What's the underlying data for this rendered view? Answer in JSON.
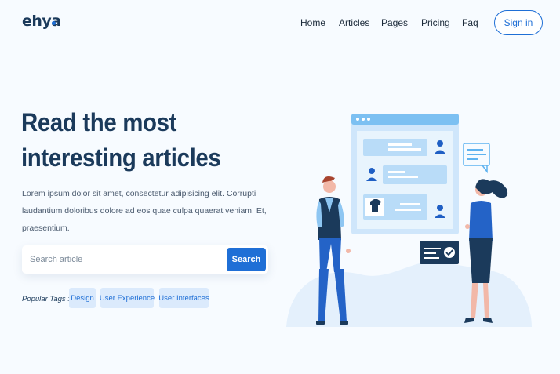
{
  "brand": {
    "logo_text": "ehya",
    "accent": "#1f6fd6",
    "dark": "#1b3a5b"
  },
  "nav": {
    "items": [
      "Home",
      "Articles",
      "Pages",
      "Pricing",
      "Faq"
    ],
    "signin_label": "Sign in"
  },
  "hero": {
    "headline_line1": "Read the most",
    "headline_line2": "interesting articles",
    "description": "Lorem ipsum dolor sit amet, consectetur adipisicing elit. Corrupti laudantium doloribus dolore ad eos quae culpa quaerat veniam. Et, praesentium."
  },
  "search": {
    "placeholder": "Search article",
    "button_label": "Search"
  },
  "tags": {
    "label": "Popular Tags :",
    "items": [
      "Design",
      "User Experience",
      "User Interfaces"
    ]
  },
  "illustration": {
    "icons": [
      "browser-window-icon",
      "user-icon",
      "tshirt-icon",
      "chat-bubble-icon",
      "check-card-icon"
    ]
  }
}
